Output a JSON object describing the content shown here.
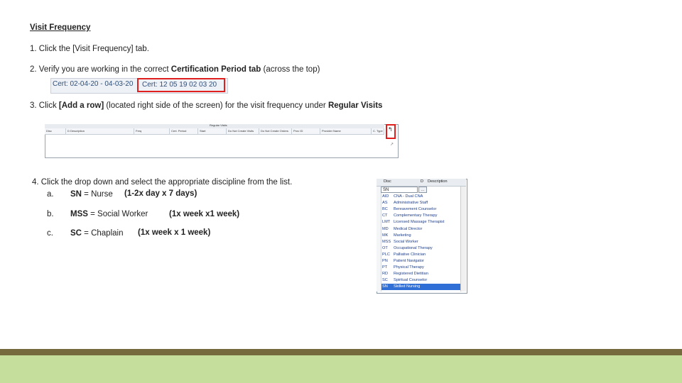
{
  "title": "Visit Frequency",
  "step1": "1. Click the [Visit Frequency] tab.",
  "step2": {
    "prefix": "2. Verify you are working in the correct ",
    "bold": "Certification Period tab",
    "suffix": " (across the top)"
  },
  "cert_tabs": [
    "Cert: 02-04-20 - 04-03-20",
    "Cert: 12 05 19   02 03 20"
  ],
  "step3": {
    "prefix": "3. Click ",
    "bold1": "[Add a row]",
    "middle": " (located right side of the screen) for the visit frequency under ",
    "bold2": "Regular Visits"
  },
  "grid": {
    "title": "Regular Visits",
    "columns": [
      "Disc",
      "D Description",
      "Freq",
      "Cert. Period",
      "Start",
      "Do Not Create Visits",
      "Do Not Create Orders",
      "Prov ID",
      "Provider Name",
      "C. Type"
    ]
  },
  "step4": {
    "line": "4.   Click the drop down and select the appropriate discipline from the list.",
    "items": [
      {
        "letter": "a.",
        "code": "SN",
        "label": " = Nurse",
        "freq": "(1-2x day x 7 days)"
      },
      {
        "letter": "b.",
        "code": "MSS",
        "label": " = Social Worker",
        "freq": "(1x week x1 week)"
      },
      {
        "letter": "c.",
        "code": "SC",
        "label": " = Chaplain",
        "freq": "(1x week x 1 week)"
      }
    ]
  },
  "dropdown": {
    "header_disc": "Disc",
    "header_d": "D",
    "header_desc": "Description",
    "input_value": "SN",
    "button_label": "...",
    "options": [
      {
        "code": "AID",
        "desc": "CNA - Dual CNA"
      },
      {
        "code": "AS",
        "desc": "Administrative Staff"
      },
      {
        "code": "BC",
        "desc": "Bereavement Counselor"
      },
      {
        "code": "CT",
        "desc": "Complementary Therapy"
      },
      {
        "code": "LMT",
        "desc": "Licensed Massage Therapist"
      },
      {
        "code": "MD",
        "desc": "Medical Director"
      },
      {
        "code": "MK",
        "desc": "Marketing"
      },
      {
        "code": "MSS",
        "desc": "Social Worker"
      },
      {
        "code": "OT",
        "desc": "Occupational Therapy"
      },
      {
        "code": "PLC",
        "desc": "Palliative Clinician"
      },
      {
        "code": "PN",
        "desc": "Patient Navigator"
      },
      {
        "code": "PT",
        "desc": "Physical Therapy"
      },
      {
        "code": "RD",
        "desc": "Registered Dietitian"
      },
      {
        "code": "SC",
        "desc": "Spiritual Counselor"
      },
      {
        "code": "SN",
        "desc": "Skilled Nursing"
      }
    ],
    "selected": "SN"
  },
  "colors": {
    "highlight_border": "#e01f1f",
    "selected_row": "#2f6fd6",
    "band_dark": "#756a3e",
    "band_light": "#c5de9b"
  }
}
